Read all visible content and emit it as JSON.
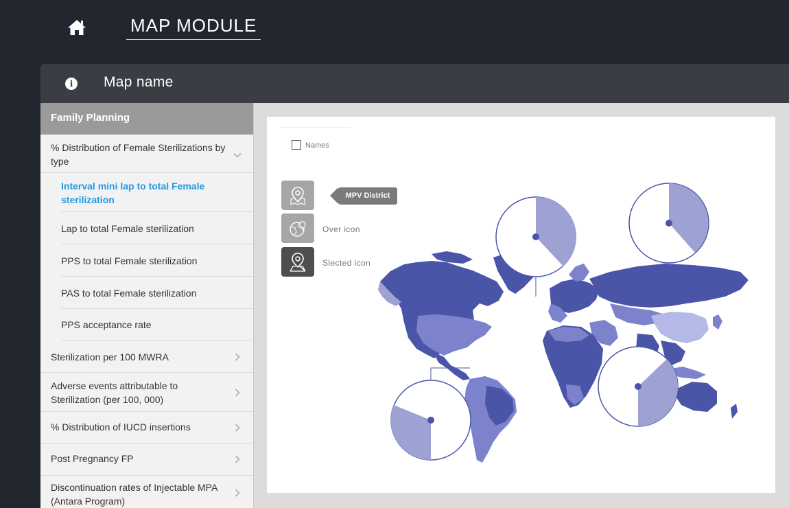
{
  "header": {
    "title": "MAP MODULE",
    "home_icon": "home-icon"
  },
  "panel": {
    "map_name": "Map name",
    "info_icon": "info-icon"
  },
  "sidebar": {
    "category": "Family Planning",
    "items": [
      {
        "label": "% Distribution of Female Sterilizations by type",
        "expanded": true
      },
      {
        "label": "Interval mini lap to total Female sterilization",
        "active": true
      },
      {
        "label": "Lap to total Female sterilization"
      },
      {
        "label": "PPS to total Female sterilization"
      },
      {
        "label": "PAS to total Female sterilization"
      },
      {
        "label": "PPS acceptance rate"
      },
      {
        "label": "Sterilization per 100 MWRA"
      },
      {
        "label": "Adverse events attributable to Sterilization (per 100, 000)"
      },
      {
        "label": "% Distribution of IUCD insertions"
      },
      {
        "label": "Post Pregnancy FP"
      },
      {
        "label": "Discontinuation rates of Injectable MPA (Antara Program)"
      }
    ]
  },
  "map": {
    "names_toggle": {
      "label": "Names",
      "checked": false
    },
    "legend": [
      {
        "label": "MPV District",
        "icon": "map-pin-icon"
      },
      {
        "label": "Over icon",
        "icon": "globe-pin-icon"
      },
      {
        "label": "Slected icon",
        "icon": "location-pin-icon"
      }
    ],
    "colors": {
      "dark": "#4a55a8",
      "medium": "#7c83cc",
      "light": "#b5b9e8",
      "pie_fill": "#9da2d2"
    }
  }
}
